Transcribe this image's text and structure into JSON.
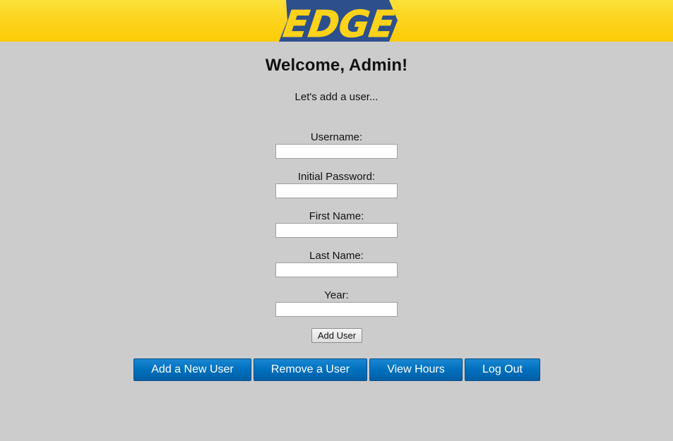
{
  "header": {
    "logo_text": "EDGE",
    "colors": {
      "bar": "#fdd21a",
      "logo_shape": "#2d4f8c",
      "logo_text": "#fdd21a"
    }
  },
  "page": {
    "title": "Welcome, Admin!",
    "subtitle": "Let's add a user..."
  },
  "form": {
    "fields": [
      {
        "label": "Username:",
        "value": "",
        "placeholder": ""
      },
      {
        "label": "Initial Password:",
        "value": "",
        "placeholder": ""
      },
      {
        "label": "First Name:",
        "value": "",
        "placeholder": ""
      },
      {
        "label": "Last Name:",
        "value": "",
        "placeholder": ""
      },
      {
        "label": "Year:",
        "value": "",
        "placeholder": ""
      }
    ],
    "submit_label": "Add User"
  },
  "nav": {
    "buttons": [
      {
        "label": "Add a New User"
      },
      {
        "label": "Remove a User"
      },
      {
        "label": "View Hours"
      },
      {
        "label": "Log Out"
      }
    ],
    "color": "#0070bd"
  }
}
